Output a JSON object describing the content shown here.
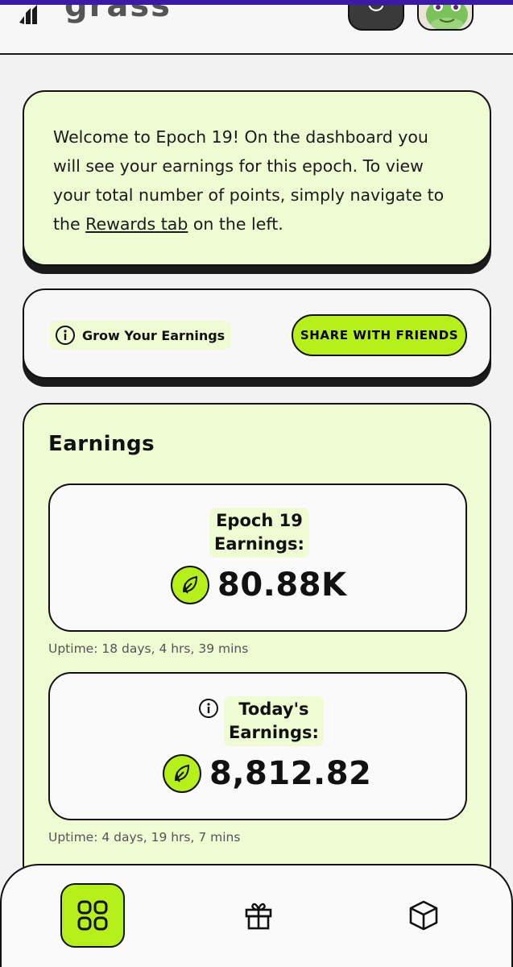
{
  "header": {
    "logo_text": "grass",
    "icons": [
      "grass-logo-mark",
      "theme-toggle-icon",
      "user-avatar"
    ]
  },
  "welcome": {
    "text_before": "Welcome to Epoch 19! On the dashboard you will see your earnings for this epoch. To view your total number of points, simply navigate to the ",
    "link_text": "Rewards tab",
    "text_after": " on the left."
  },
  "grow": {
    "label": "Grow Your Earnings",
    "button_label": "SHARE WITH FRIENDS",
    "icon": "info-icon"
  },
  "earnings": {
    "title": "Earnings",
    "epoch": {
      "label_line1": "Epoch 19",
      "label_line2": "Earnings:",
      "value": "80.88K",
      "uptime": "Uptime: 18 days, 4 hrs, 39 mins"
    },
    "today": {
      "label_line1": "Today's",
      "label_line2": "Earnings:",
      "value": "8,812.82",
      "uptime": "Uptime: 4 days, 19 hrs, 7 mins"
    }
  },
  "nav": {
    "items": [
      "dashboard-grid-icon",
      "gift-icon",
      "cube-icon"
    ],
    "active": "dashboard-grid-icon"
  },
  "colors": {
    "accent": "#b6f01a",
    "card_bg": "#effbd2",
    "page_bg": "#f2f2f2",
    "stroke": "#111111"
  }
}
